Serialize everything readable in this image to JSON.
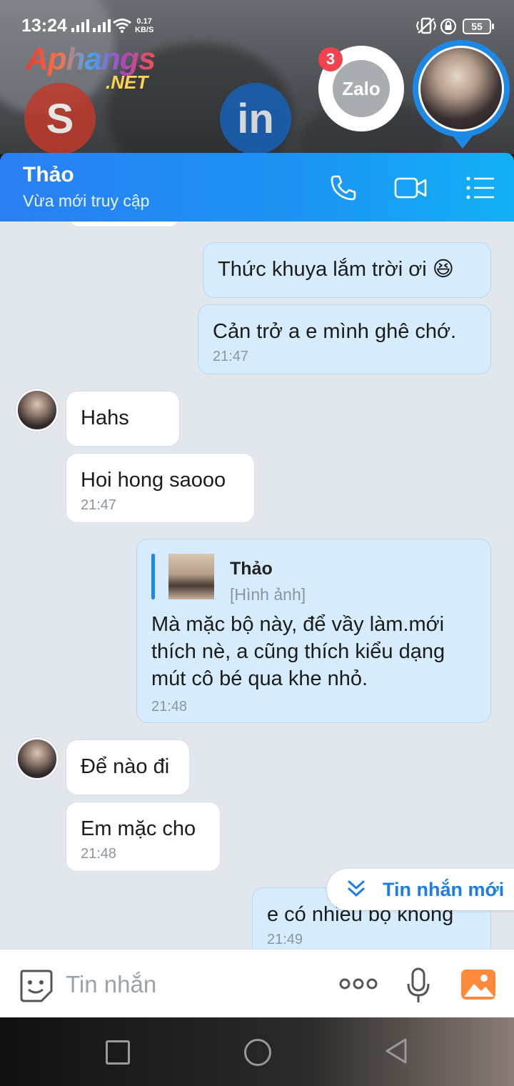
{
  "status_bar": {
    "time": "13:24",
    "net_speed_value": "0.17",
    "net_speed_unit": "KB/S",
    "battery": "55"
  },
  "overlay": {
    "watermark_main": "Aphangs",
    "watermark_sub": ".NET",
    "zalo_label": "Zalo",
    "zalo_badge": "3"
  },
  "header": {
    "contact_name": "Thảo",
    "presence": "Vừa mới truy cập"
  },
  "messages": [
    {
      "side": "out",
      "text": "Thức khuya lắm trời ơi 😆",
      "time": ""
    },
    {
      "side": "out",
      "text": "Cản trở a e mình ghê chớ.",
      "time": "21:47"
    },
    {
      "side": "in",
      "text": "Hahs",
      "time": ""
    },
    {
      "side": "in",
      "text": "Hoi hong saooo",
      "time": "21:47"
    },
    {
      "side": "out",
      "quote": {
        "name": "Thảo",
        "type": "[Hình ảnh]"
      },
      "lines": [
        "Mà mặc bộ này, để vầy làm.mới",
        "thích nè, a cũng thích kiểu dạng",
        "mút cô bé qua khe nhỏ."
      ],
      "time": "21:48"
    },
    {
      "side": "in",
      "text": "Để nào đi",
      "time": ""
    },
    {
      "side": "in",
      "text": "Em mặc cho",
      "time": "21:48"
    },
    {
      "side": "out",
      "text": "e có nhiêu bộ không",
      "time": "21:49"
    }
  ],
  "new_messages_label": "Tin nhắn mới",
  "composer": {
    "placeholder": "Tin nhắn"
  },
  "colors": {
    "header_start": "#2a7ff3",
    "header_end": "#12b0f5",
    "outgoing": "#d6ecfd",
    "incoming": "#ffffff",
    "accent": "#1e7ce6"
  },
  "icons": [
    "phone-icon",
    "video-call-icon",
    "menu-list-icon",
    "sticker-icon",
    "more-icon",
    "microphone-icon",
    "image-icon",
    "chevrons-down-icon"
  ]
}
